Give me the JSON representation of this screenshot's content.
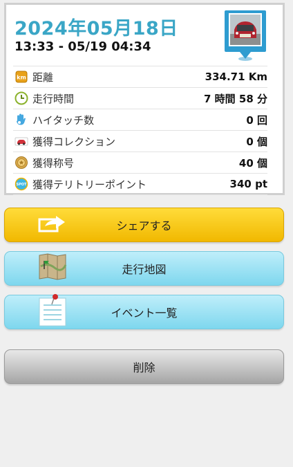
{
  "summary": {
    "date": "2024年05月18日",
    "time_range": "13:33 - 05/19 04:34"
  },
  "stats": [
    {
      "icon": "km-badge-icon",
      "label": "距離",
      "value": "334.71 Km"
    },
    {
      "icon": "clock-icon",
      "label": "走行時間",
      "value": "7 時間 58 分"
    },
    {
      "icon": "high-five-hand-icon",
      "label": "ハイタッチ数",
      "value": "0 回"
    },
    {
      "icon": "car-icon",
      "label": "獲得コレクション",
      "value": "0 個"
    },
    {
      "icon": "medal-icon",
      "label": "獲得称号",
      "value": "40 個"
    },
    {
      "icon": "spot-badge-icon",
      "label": "獲得テリトリーポイント",
      "value": "340 pt"
    }
  ],
  "icon_badges": {
    "km": "km",
    "spot": "SPOT"
  },
  "buttons": {
    "share": "シェアする",
    "route_map": "走行地図",
    "event_list": "イベント一覧",
    "delete": "削除"
  },
  "colors": {
    "date": "#3aa6c6",
    "share_button": "#f7c700",
    "blue_button": "#8fdcf0",
    "delete_button": "#b8b8b8"
  }
}
